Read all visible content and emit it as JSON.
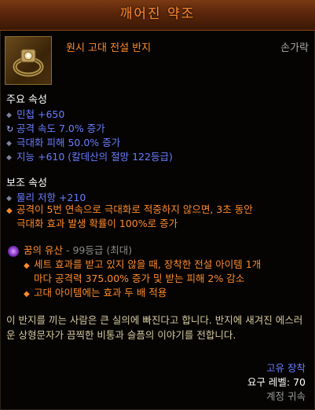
{
  "header": {
    "title": "깨어진 약조"
  },
  "item": {
    "name": "원시 고대 전설 반지",
    "slot": "손가락",
    "icon": "ring-icon"
  },
  "primary": {
    "title": "주요 속성",
    "stats": [
      {
        "text": "민첩 +650",
        "bullet": "diamond"
      },
      {
        "text": "공격 속도 7.0% 증가",
        "bullet": "spin"
      },
      {
        "text": "극대화 피해 50.0% 증가",
        "bullet": "diamond"
      },
      {
        "text": "지능 +610 (칼데산의 절망 122등급)",
        "bullet": "diamond"
      }
    ]
  },
  "secondary": {
    "title": "보조 속성",
    "stats": [
      {
        "text": "물리 저항 +210"
      }
    ],
    "legendary_line1": "공격이 5번 연속으로 극대화로 적중하지 않으면, 3초 동안",
    "legendary_line2": "극대화 효과 발생 확률이 100%로 증가"
  },
  "set": {
    "name": "꿈의 유산",
    "rank": " - 99등급 (최대)",
    "line1": "세트 효과를 받고 있지 않을 때, 장착한 전설 아이템 1개",
    "line2": "마다 공격력 375.00% 증가 및 받는 피해 2% 감소",
    "line3": "고대 아이템에는 효과 두 배 적용"
  },
  "flavor": "이 반지를 끼는 사람은 큰 실의에 빠진다고 합니다. 반지에 새겨진 에스러운 상형문자가 끔찍한 비통과 슬픔의 이야기를 전합니다.",
  "footer": {
    "unique": "고유 장착",
    "required_level": "요구 레벨: 70",
    "bind": "계정 귀속"
  },
  "colors": {
    "legendary": "#ff8a2a",
    "magic": "#6a7cff",
    "flavor": "#d8c9a0"
  }
}
